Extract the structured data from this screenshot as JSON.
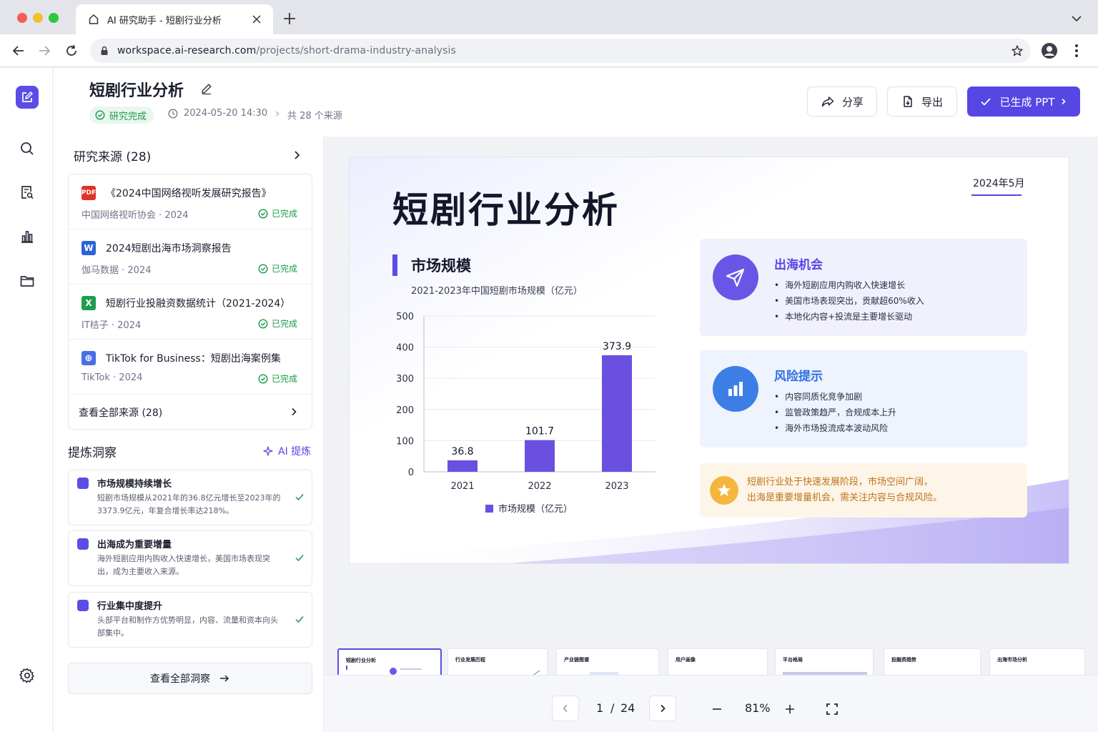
{
  "browser": {
    "tab_title": "AI 研究助手 - 短剧行业分析",
    "url_host": "workspace.ai-research.com",
    "url_path": "/projects/short-drama-industry-analysis"
  },
  "header": {
    "title": "短剧行业分析",
    "status": "研究完成",
    "timestamp": "2024-05-20 14:30",
    "source_count": "共 28 个来源",
    "share_label": "分享",
    "export_label": "导出",
    "ppt_label": "已生成 PPT"
  },
  "sources": {
    "heading": "研究来源 (28)",
    "items": [
      {
        "icon": "PDF",
        "icon_name": "pdf-icon",
        "color": "#e0322b",
        "title": "《2024中国网络视听发展研究报告》",
        "meta": "中国网络视听协会 · 2024",
        "state": "已完成"
      },
      {
        "icon": "W",
        "icon_name": "word-icon",
        "color": "#2b63d9",
        "title": "2024短剧出海市场洞察报告",
        "meta": "伽马数据 · 2024",
        "state": "已完成"
      },
      {
        "icon": "X",
        "icon_name": "excel-icon",
        "color": "#1e9e4e",
        "title": "短剧行业投融资数据统计（2021-2024）",
        "meta": "IT桔子 · 2024",
        "state": "已完成"
      },
      {
        "icon": "⊕",
        "icon_name": "web-icon",
        "color": "#4a6ee8",
        "title": "TikTok for Business：短剧出海案例集",
        "meta": "TikTok · 2024",
        "state": "已完成"
      }
    ],
    "view_all": "查看全部来源 (28)"
  },
  "insights": {
    "heading": "提炼洞察",
    "ai_label": "AI 提炼",
    "items": [
      {
        "title": "市场规模持续增长",
        "body": "短剧市场规模从2021年的36.8亿元增长至2023年的3373.9亿元，年复合增长率达218%。"
      },
      {
        "title": "出海成为重要增量",
        "body": "海外短剧应用内购收入快速增长，美国市场表现突出，成为主要收入来源。"
      },
      {
        "title": "行业集中度提升",
        "body": "头部平台和制作方优势明显，内容、流量和资本向头部集中。"
      }
    ],
    "view_all": "查看全部洞察"
  },
  "slide": {
    "title": "短剧行业分析",
    "date": "2024年5月",
    "section": "市场规模",
    "chart_subtitle": "2021-2023年中国短剧市场规模（亿元）",
    "opportunity": {
      "title": "出海机会",
      "color": "#5646e4",
      "points": [
        "海外短剧应用内购收入快速增长",
        "美国市场表现突出，贡献超60%收入",
        "本地化内容+投流是主要增长驱动"
      ]
    },
    "risk": {
      "title": "风险提示",
      "color": "#2f6ee0",
      "points": [
        "内容同质化竞争加剧",
        "监管政策趋严，合规成本上升",
        "海外市场投流成本波动风险"
      ]
    },
    "note_line1": "短剧行业处于快速发展阶段，市场空间广阔，",
    "note_line2": "出海是重要增量机会，需关注内容与合规风险。"
  },
  "chart_data": {
    "type": "bar",
    "categories": [
      "2021",
      "2022",
      "2023"
    ],
    "series": [
      {
        "name": "市场规模（亿元）",
        "values": [
          36.8,
          101.7,
          373.9
        ]
      }
    ],
    "data_labels": [
      "36.8",
      "101.7",
      "373.9"
    ],
    "ylim": [
      0,
      500
    ],
    "yticks": [
      "0",
      "100",
      "200",
      "300",
      "400",
      "500"
    ],
    "bar_color": "#6b4fe0",
    "grid": true,
    "legend": "bottom"
  },
  "thumbnails": [
    {
      "num": "1",
      "title": "短剧行业分析"
    },
    {
      "num": "2",
      "title": "行业发展历程"
    },
    {
      "num": "3",
      "title": "产业链图谱"
    },
    {
      "num": "4",
      "title": "用户画像"
    },
    {
      "num": "5",
      "title": "平台格局"
    },
    {
      "num": "6",
      "title": "投融资趋势"
    },
    {
      "num": "7",
      "title": "出海市场分析"
    }
  ],
  "pager": {
    "current": "1",
    "sep": "/",
    "total": "24",
    "zoom": "81%"
  }
}
